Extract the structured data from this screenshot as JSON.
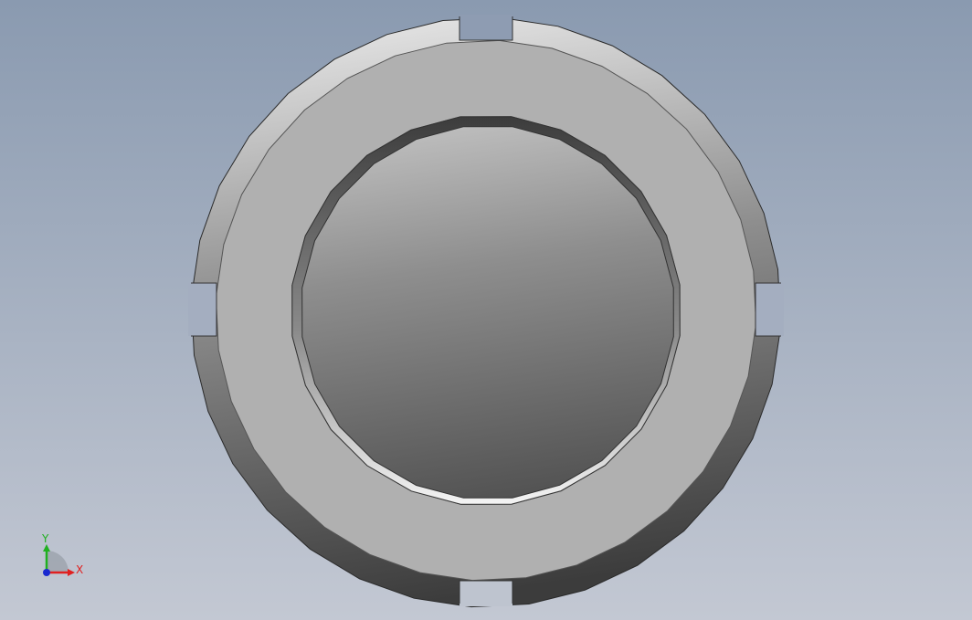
{
  "viewport": {
    "background_top": "#8a9ab0",
    "background_bottom": "#c3c8d3"
  },
  "part": {
    "face_color": "#b0b0b0",
    "edge_light": "#e6e6e6",
    "edge_dark": "#4a4a4a",
    "outline": "#2a2a2a"
  },
  "triad": {
    "x_label": "X",
    "y_label": "Y",
    "x_color": "#e02020",
    "y_color": "#20b020",
    "z_color": "#1a2ad0"
  }
}
